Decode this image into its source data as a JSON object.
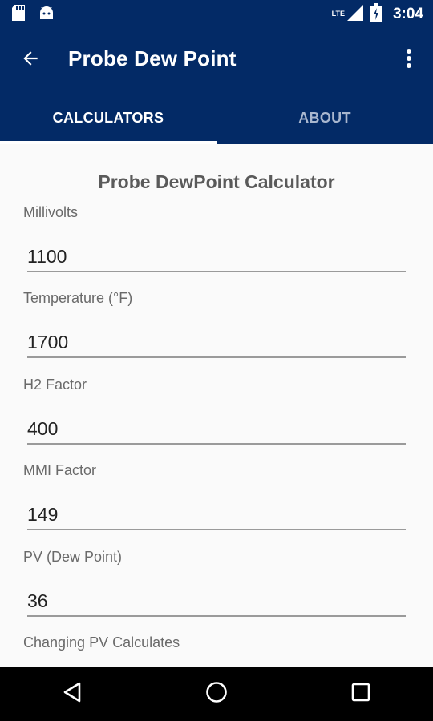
{
  "status_bar": {
    "time": "3:04",
    "network": "LTE"
  },
  "app_bar": {
    "title": "Probe Dew Point"
  },
  "tabs": [
    {
      "label": "CALCULATORS",
      "active": true
    },
    {
      "label": "ABOUT",
      "active": false
    }
  ],
  "calculator": {
    "title": "Probe DewPoint Calculator",
    "fields": [
      {
        "label": "Millivolts",
        "value": "1100"
      },
      {
        "label": "Temperature (°F)",
        "value": "1700"
      },
      {
        "label": "H2 Factor",
        "value": "400"
      },
      {
        "label": "MMI Factor",
        "value": "149"
      },
      {
        "label": "PV (Dew Point)",
        "value": "36"
      }
    ],
    "footer_label": "Changing PV Calculates"
  },
  "colors": {
    "primary": "#032a66",
    "tab_inactive": "#a9b7cf",
    "background": "#fafafa"
  }
}
